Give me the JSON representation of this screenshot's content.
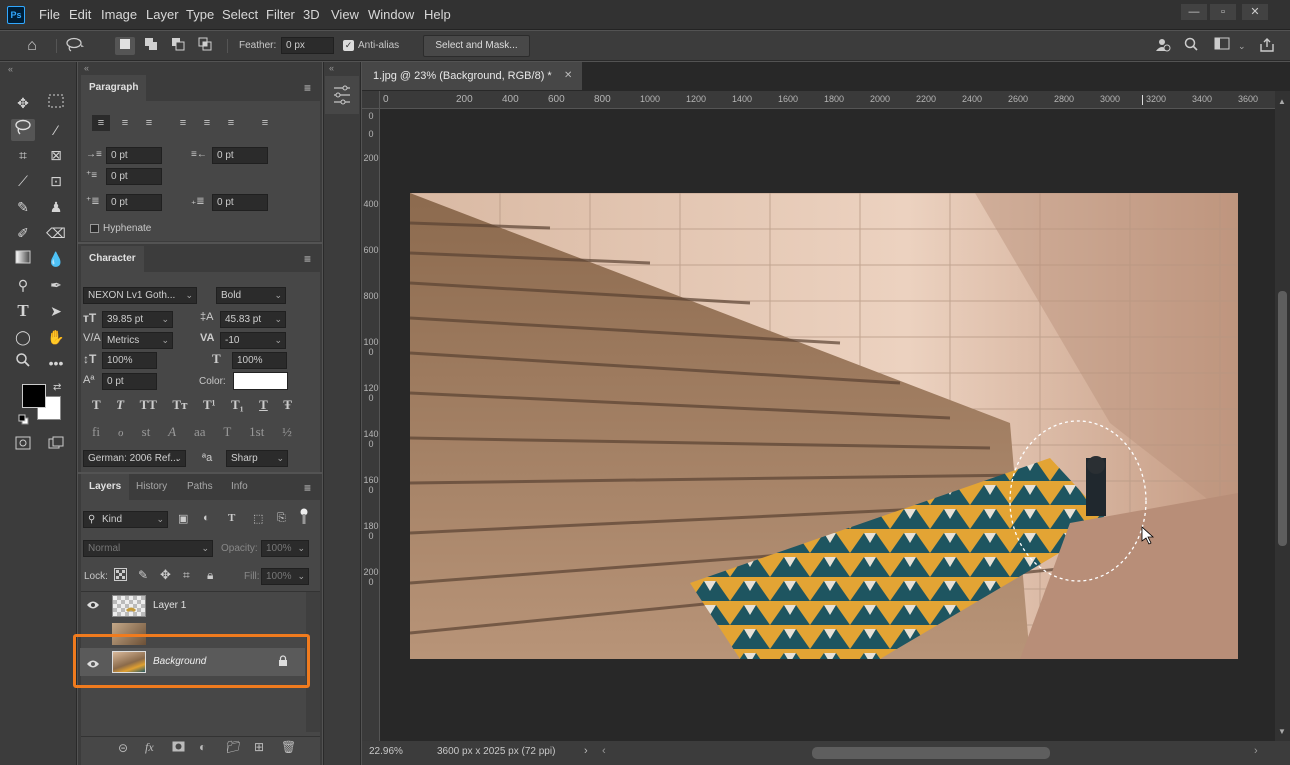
{
  "app": {
    "logo_text": "Ps"
  },
  "menu": [
    "File",
    "Edit",
    "Image",
    "Layer",
    "Type",
    "Select",
    "Filter",
    "3D",
    "View",
    "Window",
    "Help"
  ],
  "options_bar": {
    "feather_label": "Feather:",
    "feather_value": "0 px",
    "antialias_label": "Anti-alias",
    "select_mask_label": "Select and Mask..."
  },
  "colors": {
    "foreground": "#000000",
    "background": "#ffffff",
    "accent_highlight": "#f07b1e"
  },
  "paragraph_panel": {
    "tab": "Paragraph",
    "indent_left": "0 pt",
    "indent_right": "0 pt",
    "indent_first": "0 pt",
    "space_before": "0 pt",
    "space_after": "0 pt",
    "hyphenate_label": "Hyphenate"
  },
  "character_panel": {
    "tab": "Character",
    "font_family": "NEXON Lv1 Goth...",
    "font_style": "Bold",
    "font_size": "39.85 pt",
    "leading": "45.83 pt",
    "kerning": "Metrics",
    "tracking": "-10",
    "vertical_scale": "100%",
    "horizontal_scale": "100%",
    "baseline_shift": "0 pt",
    "color_label": "Color:",
    "style_buttons": [
      "T",
      "T",
      "TT",
      "Tт",
      "T¹",
      "T₁",
      "T",
      "Ŧ"
    ],
    "opentype_buttons": [
      "fi",
      "ℴ",
      "st",
      "A",
      "aa",
      "T",
      "1st",
      "½"
    ],
    "language": "German: 2006 Ref...",
    "aa_label": "ªa",
    "antialias_method": "Sharp"
  },
  "layers_panel": {
    "tabs": [
      "Layers",
      "History",
      "Paths",
      "Info"
    ],
    "filter_kind": "Kind",
    "blend_mode": "Normal",
    "opacity_label": "Opacity:",
    "opacity_value": "100%",
    "lock_label": "Lock:",
    "fill_label": "Fill:",
    "fill_value": "100%",
    "layers": [
      {
        "name": "Layer 1",
        "visible": true
      },
      {
        "name": "",
        "visible": false
      },
      {
        "name": "Background",
        "visible": true,
        "locked": true,
        "selected": true
      }
    ]
  },
  "document": {
    "tab_title": "1.jpg @ 23% (Background, RGB/8) *",
    "ruler_top": [
      "0",
      "200",
      "400",
      "600",
      "800",
      "1000",
      "1200",
      "1400",
      "1600",
      "1800",
      "2000",
      "2200",
      "2400",
      "2600",
      "2800",
      "3000",
      "3200",
      "3400",
      "3600"
    ],
    "ruler_left": [
      "0",
      "0",
      "200",
      "400",
      "600",
      "800",
      "1000",
      "1200",
      "1400",
      "1600",
      "1800",
      "2000"
    ],
    "zoom": "22.96%",
    "doc_info": "3600 px x 2025 px (72 ppi)"
  }
}
